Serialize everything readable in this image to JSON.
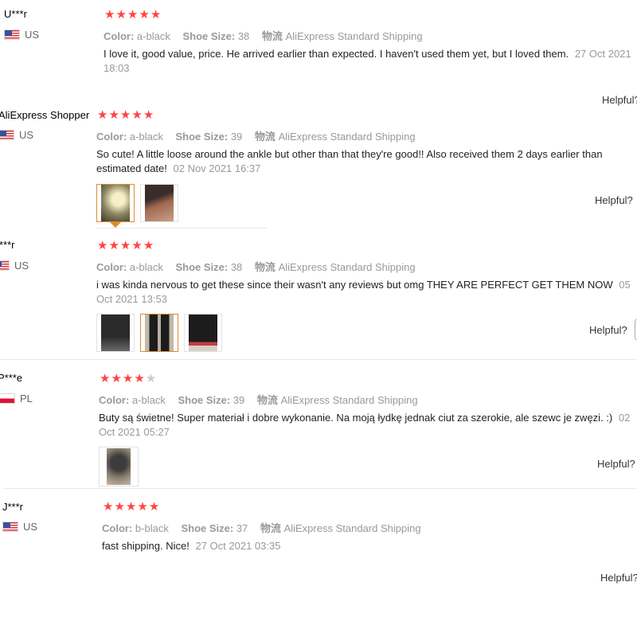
{
  "labels": {
    "color": "Color:",
    "size": "Shoe Size:",
    "ship": "物流"
  },
  "reviews": [
    {
      "user": "U***r",
      "country": "US",
      "rating": 5,
      "color": "a-black",
      "size": "38",
      "shipping": "AliExpress Standard Shipping",
      "text": "I love it, good value, price. He arrived earlier than expected. I haven't used them yet, but I loved them.",
      "date": "27 Oct 2021 18:03",
      "helpful": "Helpful?"
    },
    {
      "user": "AliExpress Shopper",
      "country": "US",
      "rating": 5,
      "color": "a-black",
      "size": "39",
      "shipping": "AliExpress Standard Shipping",
      "text": "So cute! A little loose around the ankle but other than that they're good!! Also received them 2 days earlier than estimated date!",
      "date": "02 Nov 2021 16:37",
      "helpful": "Helpful?"
    },
    {
      "user": "***r",
      "country": "US",
      "rating": 5,
      "color": "a-black",
      "size": "38",
      "shipping": "AliExpress Standard Shipping",
      "text": "i was kinda nervous to get these since their wasn't any reviews but omg THEY ARE PERFECT GET THEM NOW",
      "date": "05 Oct 2021 13:53",
      "helpful": "Helpful?"
    },
    {
      "user": "P***e",
      "country": "PL",
      "rating": 4,
      "color": "a-black",
      "size": "39",
      "shipping": "AliExpress Standard Shipping",
      "text": "Buty są świetne! Super materiał i dobre wykonanie. Na moją łydkę jednak ciut za szerokie, ale szewc je zwęzi. :)",
      "date": "02 Oct 2021 05:27",
      "helpful": "Helpful?"
    },
    {
      "user": "J***r",
      "country": "US",
      "rating": 5,
      "color": "b-black",
      "size": "37",
      "shipping": "AliExpress Standard Shipping",
      "text": "fast shipping. Nice!",
      "date": "27 Oct 2021 03:35",
      "helpful": "Helpful?"
    }
  ],
  "colors": {
    "star": "#ff4444",
    "star_off": "#cccccc",
    "thumb_active": "#e08a2c"
  }
}
